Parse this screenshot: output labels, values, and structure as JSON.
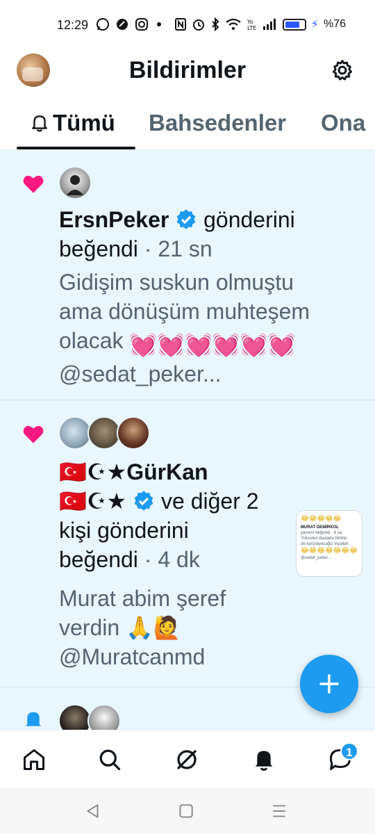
{
  "status_bar": {
    "time": "12:29",
    "left_icons": [
      "whatsapp-icon",
      "ride-icon",
      "instagram-icon",
      "dot-icon"
    ],
    "right_icons": [
      "nfc-icon",
      "alarm-icon",
      "bluetooth-icon",
      "wifi-icon",
      "volte-icon",
      "signal-icon"
    ],
    "battery_percent": "%76",
    "battery_level": 0.76
  },
  "header": {
    "title": "Bildirimler"
  },
  "tabs": [
    {
      "label": "Tümü",
      "active": true
    },
    {
      "label": "Bahsedenler",
      "active": false
    },
    {
      "label": "Ona",
      "active": false
    }
  ],
  "notifications": [
    {
      "type": "like",
      "user": "ErsnPeker",
      "verified": true,
      "action": "gönderini",
      "action2": "beğendi",
      "time": "21 sn",
      "body_line1": "Gidişim suskun olmuştu",
      "body_line2": "ama dönüşüm muhteşem",
      "body_line3": "olacak",
      "body_emoji": "💓💓💓💓💓💓",
      "body_line4": "@sedat_peker..."
    },
    {
      "type": "like",
      "user_line": "🇹🇷☪★GürKan",
      "user2_prefix": "🇹🇷☪★",
      "verified": true,
      "action": "ve diğer 2",
      "action2": "kişi gönderini",
      "action3": "beğendi",
      "time": "4 dk",
      "body_line1": "Murat abim şeref",
      "body_line2": "verdin",
      "body_emoji": "🙏🙋",
      "body_line3": "@Muratcanmd",
      "thumb": {
        "emoji_row": "😂😂😂😂😂",
        "name": "MURAT DEMİRKOL",
        "sub": "yanıtını beğendi · 6 sa",
        "text1": "Yükselen dualarla birlikte",
        "text2": "de karşılayacağız inşallah",
        "emoji_row2": "😂😂😂😂😂😂😂",
        "handle": "@sedat_peker..."
      }
    }
  ],
  "bottom_nav": {
    "items": [
      "home-icon",
      "search-icon",
      "grok-icon",
      "notifications-icon",
      "messages-icon"
    ],
    "messages_badge": "1"
  },
  "colors": {
    "accent": "#1d9bf0",
    "like": "#f91880",
    "feed_bg": "#e8f6fd"
  }
}
